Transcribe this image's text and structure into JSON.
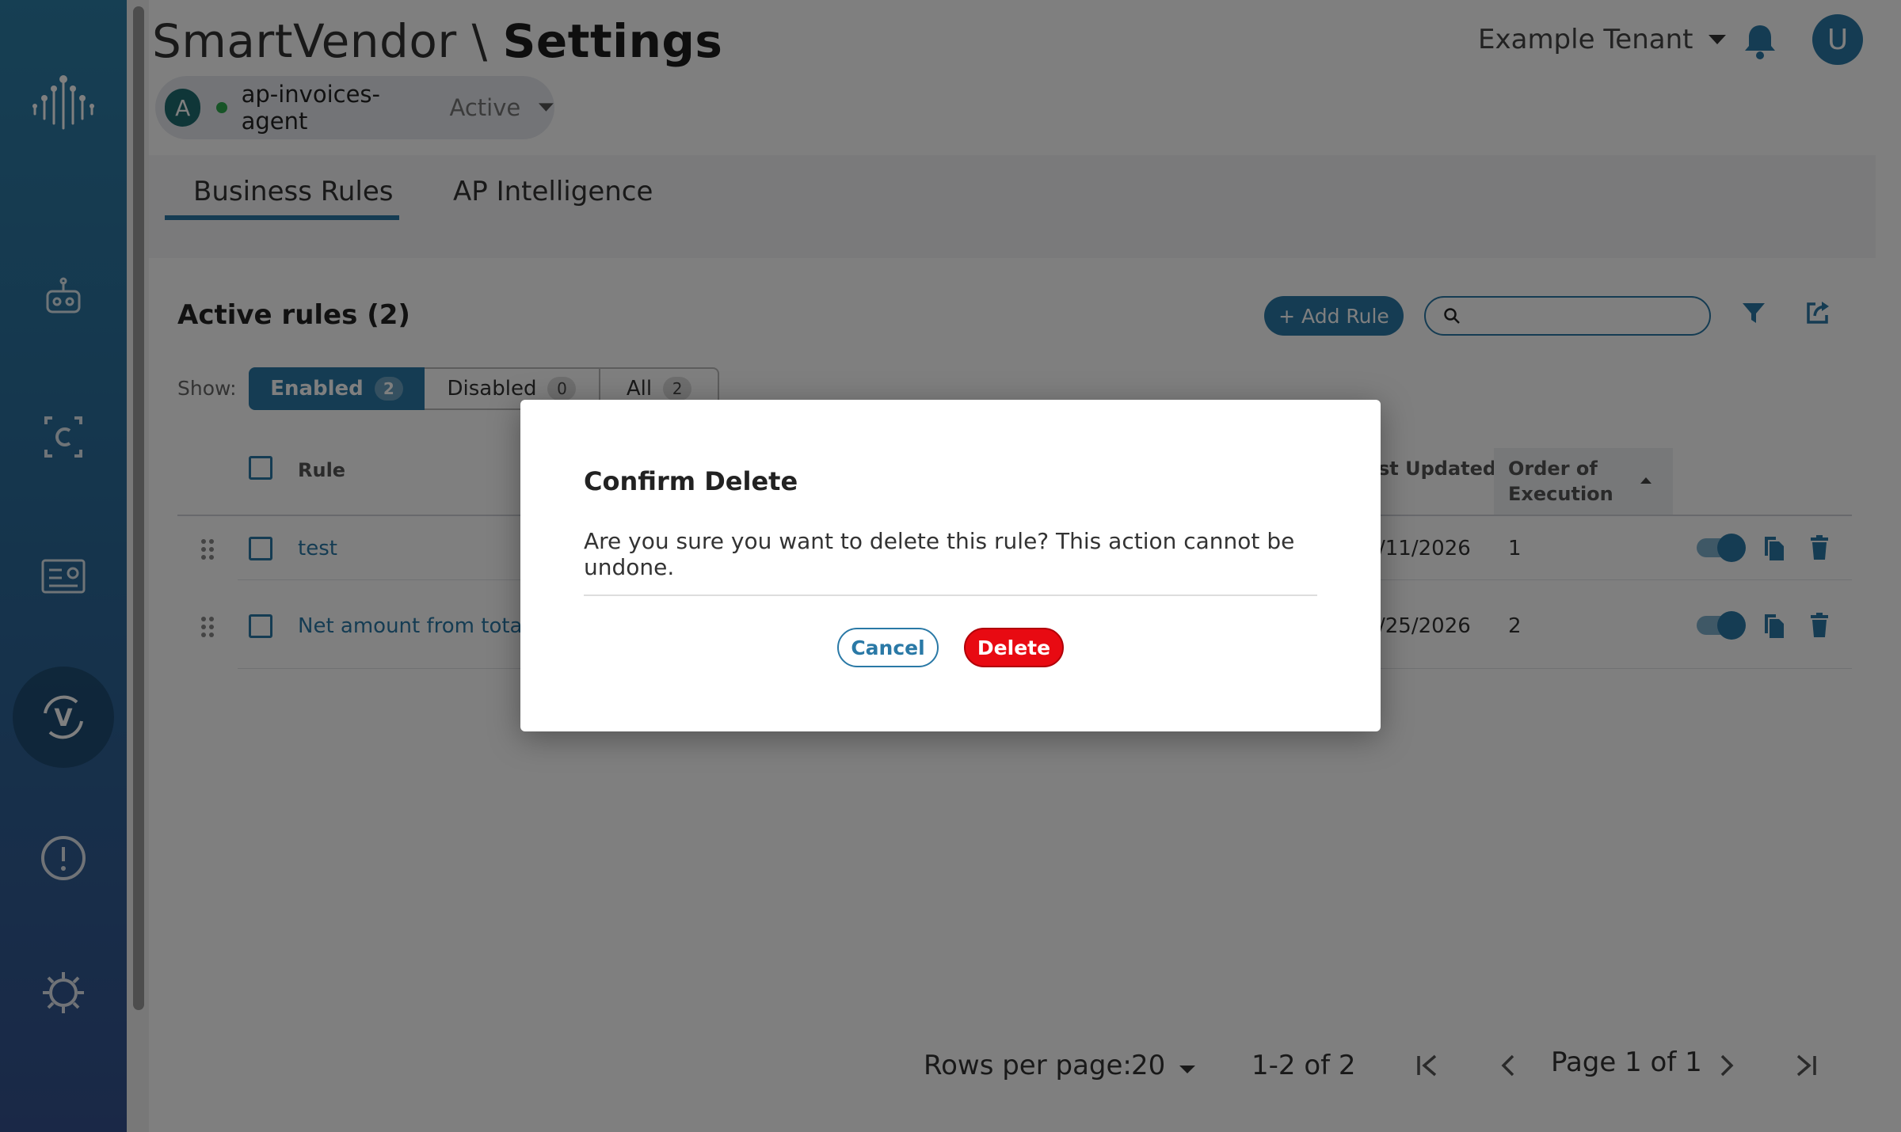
{
  "header": {
    "app_name": "SmartVendor \\",
    "page": "Settings",
    "tenant": "Example Tenant",
    "user_initial": "U"
  },
  "agent": {
    "initial": "A",
    "name": "ap-invoices-agent",
    "status": "Active"
  },
  "sidebar": {
    "items": [
      {
        "icon": "logo-icon"
      },
      {
        "icon": "robot-icon"
      },
      {
        "icon": "contract-icon"
      },
      {
        "icon": "dashboard-icon"
      },
      {
        "icon": "validation-icon",
        "active": true
      },
      {
        "icon": "alert-icon"
      },
      {
        "icon": "settings-icon"
      }
    ]
  },
  "tabs": [
    {
      "label": "Business Rules",
      "active": true
    },
    {
      "label": "AP Intelligence"
    }
  ],
  "rules": {
    "title": "Active rules (2)",
    "add_label": "+ Add Rule",
    "search_placeholder": "",
    "show_label": "Show:",
    "filters": [
      {
        "label": "Enabled",
        "count": "2",
        "selected": true
      },
      {
        "label": "Disabled",
        "count": "0"
      },
      {
        "label": "All",
        "count": "2"
      }
    ],
    "columns": {
      "rule": "Rule",
      "last_updated": "st Updated",
      "order_line1": "Order of",
      "order_line2": "Execution"
    },
    "rows": [
      {
        "name": "test",
        "updated": "/11/2026",
        "order": "1",
        "enabled": true
      },
      {
        "name": "Net amount from total l",
        "updated": "/25/2026",
        "order": "2",
        "enabled": true
      }
    ]
  },
  "pagination": {
    "rows_per_page_label": "Rows per page:",
    "rows_per_page": "20",
    "range": "1-2 of 2",
    "page": "Page 1 of 1"
  },
  "modal": {
    "title": "Confirm Delete",
    "body": "Are you sure you want to delete this rule? This action cannot be undone.",
    "cancel_label": "Cancel",
    "delete_label": "Delete"
  },
  "colors": {
    "accent": "#2a79a6",
    "danger": "#e80a12",
    "active_dot": "#2fa84f"
  }
}
